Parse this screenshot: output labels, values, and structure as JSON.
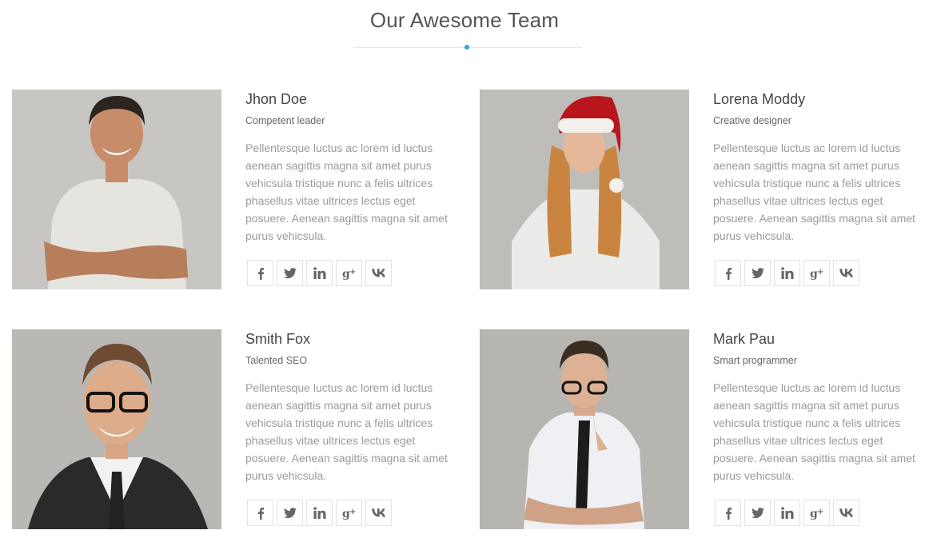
{
  "section": {
    "title": "Our Awesome Team",
    "accent_color": "#29a8dd"
  },
  "members": [
    {
      "name": "Jhon Doe",
      "role": "Competent leader",
      "bio": "Pellentesque luctus ac lorem id luctus aenean sagittis magna sit amet purus vehicsula tristique nunc a felis ultrices phasellus vitae ultrices lectus eget posuere. Aenean sagittis magna sit amet purus vehicsula."
    },
    {
      "name": "Lorena Moddy",
      "role": "Creative designer",
      "bio": "Pellentesque luctus ac lorem id luctus aenean sagittis magna sit amet purus vehicsula tristique nunc a felis ultrices phasellus vitae ultrices lectus eget posuere. Aenean sagittis magna sit amet purus vehicsula."
    },
    {
      "name": "Smith Fox",
      "role": "Talented SEO",
      "bio": "Pellentesque luctus ac lorem id luctus aenean sagittis magna sit amet purus vehicsula tristique nunc a felis ultrices phasellus vitae ultrices lectus eget posuere. Aenean sagittis magna sit amet purus vehicsula."
    },
    {
      "name": "Mark Pau",
      "role": "Smart programmer",
      "bio": "Pellentesque luctus ac lorem id luctus aenean sagittis magna sit amet purus vehicsula tristique nunc a felis ultrices phasellus vitae ultrices lectus eget posuere. Aenean sagittis magna sit amet purus vehicsula."
    }
  ],
  "social_icons": [
    "facebook-icon",
    "twitter-icon",
    "linkedin-icon",
    "google-plus-icon",
    "vk-icon"
  ]
}
